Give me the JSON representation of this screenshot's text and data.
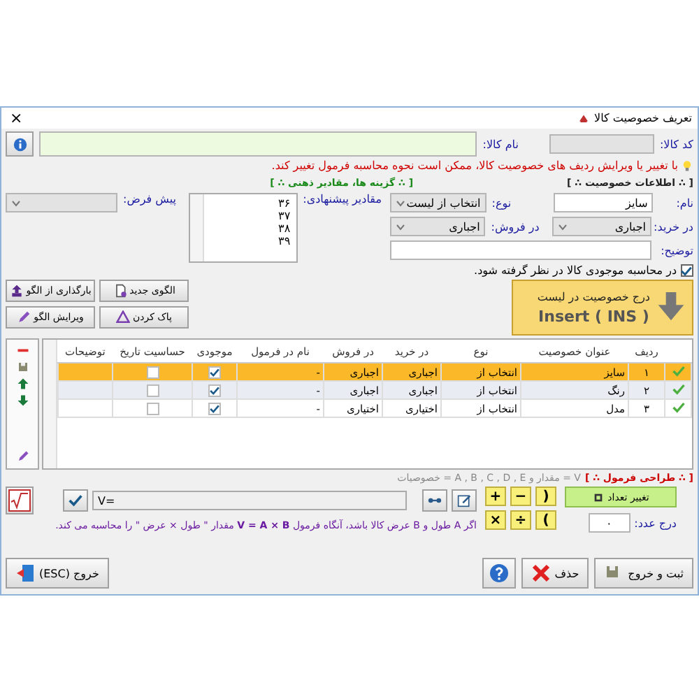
{
  "window": {
    "title": "تعریف خصوصیت کالا",
    "close": "×"
  },
  "header": {
    "code_label": "کد کالا:",
    "name_label": "نام کالا:"
  },
  "warning": "با تغییر یا ویرایش ردیف های خصوصیت کالا، ممکن است نحوه محاسبه فرمول تغییر کند.",
  "property_section": {
    "title": "[ ∴ اطلاعات خصوصیت ∴ ]",
    "fields": [
      {
        "kind": "input",
        "label": "نام:",
        "value": "سایز"
      },
      {
        "kind": "select",
        "label": "نوع:",
        "value": "انتخاب از لیست",
        "disabled": true
      },
      {
        "kind": "select",
        "label": "در خرید:",
        "value": "اجباری",
        "disabled": true
      },
      {
        "kind": "select",
        "label": "در فروش:",
        "value": "اجباری",
        "disabled": true
      },
      {
        "kind": "input",
        "label": "توضیح:"
      }
    ],
    "stock_checkbox": {
      "label": "در محاسبه موجودی کالا در نظر گرفته شود.",
      "checked": true
    }
  },
  "options_section": {
    "title": "[ ∴ گزینه ها، مقادیر ذهنی ∴ ]",
    "suggested_label": "مقادیر پیشنهادی:",
    "suggested_values": [
      "۳۶",
      "۳۷",
      "۳۸",
      "۳۹"
    ],
    "default_label": "پیش فرض:",
    "default_disabled": true
  },
  "template_buttons": [
    {
      "label": "الگوی جدید"
    },
    {
      "label": "بارگذاری از الگو"
    },
    {
      "label": "پاک کردن"
    },
    {
      "label": "ویرایش الگو"
    }
  ],
  "insert_button": {
    "label": "درج خصوصیت در لیست",
    "shortcut": "Insert ( INS )"
  },
  "table": {
    "columns": [
      "ردیف",
      "عنوان خصوصیت",
      "نوع",
      "در خرید",
      "در فروش",
      "نام در فرمول",
      "موجودی",
      "حساسیت تاریخ",
      "توضیحات"
    ],
    "rows": [
      {
        "selected": true,
        "number": "۱",
        "title": "سایز",
        "type": "انتخاب از",
        "purchase": "اجباری",
        "sale": "اجباری",
        "formula_name": "-",
        "stock": true,
        "date_sensitive": false
      },
      {
        "selected": false,
        "number": "۲",
        "title": "رنگ",
        "type": "انتخاب از",
        "purchase": "اجباری",
        "sale": "اجباری",
        "formula_name": "-",
        "stock": true,
        "date_sensitive": false
      },
      {
        "selected": false,
        "number": "۳",
        "title": "مدل",
        "type": "انتخاب از",
        "purchase": "اختیاری",
        "sale": "اختیاری",
        "formula_name": "-",
        "stock": true,
        "date_sensitive": false
      }
    ]
  },
  "formula": {
    "title": "[ ∴ طراحی فرمول ∴ ]",
    "legend": "V = مقدار و A , B , C , D , E = خصوصیات",
    "value": "V=",
    "operators": [
      ")",
      "−",
      "+",
      "(",
      "÷",
      "×"
    ],
    "change_count": "تغییر تعداد",
    "number_label": "درج عدد:",
    "number_value": "۰",
    "hint": "اگر A طول و B عرض کالا باشد، آنگاه فرمول **V = A × B** مقدار \" طول × عرض \" را محاسبه می کند."
  },
  "footer": {
    "save_exit": "ثبت و خروج",
    "delete": "حذف",
    "exit": "خروج (ESC)"
  }
}
